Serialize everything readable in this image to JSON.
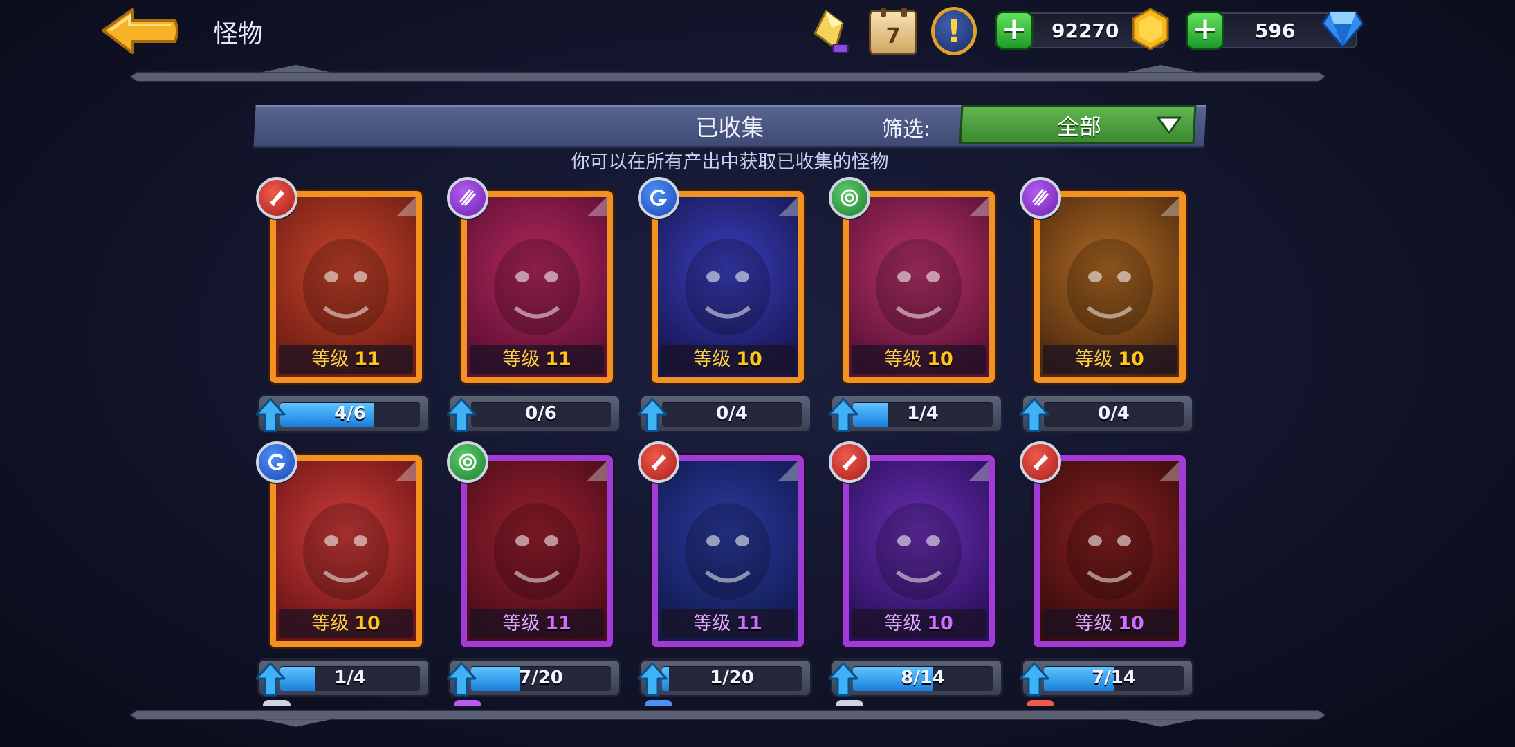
{
  "header": {
    "title": "怪物",
    "back_icon": "back-arrow-icon",
    "calendar_day": "7",
    "alert_mark": "!",
    "coins": "92270",
    "gems": "596"
  },
  "filter": {
    "collected_label": "已收集",
    "filter_label": "筛选:",
    "selected": "全部",
    "hint": "你可以在所有产出中获取已收集的怪物"
  },
  "cards": [
    {
      "rarity": "legendary",
      "class": "red",
      "level_label": "等级",
      "level": "11",
      "progress": "4/6",
      "fill": 0.667,
      "art_colors": [
        "#c8432a",
        "#6e1d13"
      ]
    },
    {
      "rarity": "legendary",
      "class": "purple",
      "level_label": "等级",
      "level": "11",
      "progress": "0/6",
      "fill": 0,
      "art_colors": [
        "#b4275a",
        "#5b0f35"
      ]
    },
    {
      "rarity": "legendary",
      "class": "blue",
      "level_label": "等级",
      "level": "10",
      "progress": "0/4",
      "fill": 0,
      "art_colors": [
        "#3b3fbf",
        "#16164f"
      ]
    },
    {
      "rarity": "legendary",
      "class": "green",
      "level_label": "等级",
      "level": "10",
      "progress": "1/4",
      "fill": 0.25,
      "art_colors": [
        "#b8336a",
        "#5a1036"
      ]
    },
    {
      "rarity": "legendary",
      "class": "purple",
      "level_label": "等级",
      "level": "10",
      "progress": "0/4",
      "fill": 0,
      "art_colors": [
        "#b06a22",
        "#4d2a0f"
      ]
    },
    {
      "rarity": "legendary",
      "class": "blue",
      "level_label": "等级",
      "level": "10",
      "progress": "1/4",
      "fill": 0.25,
      "art_colors": [
        "#cf3d3a",
        "#6b1414"
      ]
    },
    {
      "rarity": "epic",
      "class": "green",
      "level_label": "等级",
      "level": "11",
      "progress": "7/20",
      "fill": 0.35,
      "art_colors": [
        "#9a2030",
        "#4a0c18"
      ]
    },
    {
      "rarity": "epic",
      "class": "red",
      "level_label": "等级",
      "level": "11",
      "progress": "1/20",
      "fill": 0.05,
      "art_colors": [
        "#2b3aa0",
        "#101a4e"
      ]
    },
    {
      "rarity": "epic",
      "class": "red",
      "level_label": "等级",
      "level": "10",
      "progress": "8/14",
      "fill": 0.571,
      "art_colors": [
        "#6a2fb4",
        "#2a0f5a"
      ]
    },
    {
      "rarity": "epic",
      "class": "red",
      "level_label": "等级",
      "level": "10",
      "progress": "7/14",
      "fill": 0.5,
      "art_colors": [
        "#8a2020",
        "#3a0c0c"
      ]
    }
  ],
  "colors": {
    "legendary_frame": "#f29221",
    "epic_frame": "#a13bd6",
    "progress_fill": "#2a90e8",
    "filter_green": "#4e9e3c"
  }
}
